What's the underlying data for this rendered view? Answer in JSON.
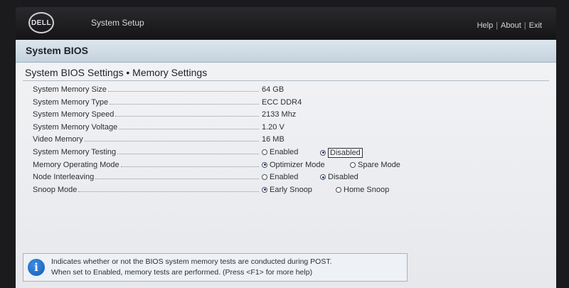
{
  "header": {
    "logo_text": "DELL",
    "app_title": "System Setup",
    "links": [
      "Help",
      "About",
      "Exit"
    ],
    "separator": "|"
  },
  "section_title": "System BIOS",
  "page_title": "System BIOS Settings • Memory Settings",
  "settings": [
    {
      "label": "System Memory Size",
      "value": "64 GB"
    },
    {
      "label": "System Memory Type",
      "value": "ECC DDR4"
    },
    {
      "label": "System Memory Speed",
      "value": "2133 Mhz"
    },
    {
      "label": "System Memory Voltage",
      "value": "1.20 V"
    },
    {
      "label": "Video Memory",
      "value": "16 MB"
    },
    {
      "label": "System Memory Testing",
      "options": [
        "Enabled",
        "Disabled"
      ],
      "selected": "Disabled"
    },
    {
      "label": "Memory Operating Mode",
      "options": [
        "Optimizer Mode",
        "Spare Mode"
      ],
      "selected": "Optimizer Mode"
    },
    {
      "label": "Node Interleaving",
      "options": [
        "Enabled",
        "Disabled"
      ],
      "selected": "Disabled"
    },
    {
      "label": "Snoop Mode",
      "options": [
        "Early Snoop",
        "Home Snoop"
      ],
      "selected": "Early Snoop"
    }
  ],
  "help": {
    "line1": "Indicates whether or not the BIOS system memory tests are conducted during POST.",
    "line2": "When set to Enabled, memory tests are performed. (Press <F1> for more help)"
  },
  "colors": {
    "accent_radio": "#1f3a93",
    "section_bar": "#c4d2de",
    "info_icon": "#145bb0"
  }
}
